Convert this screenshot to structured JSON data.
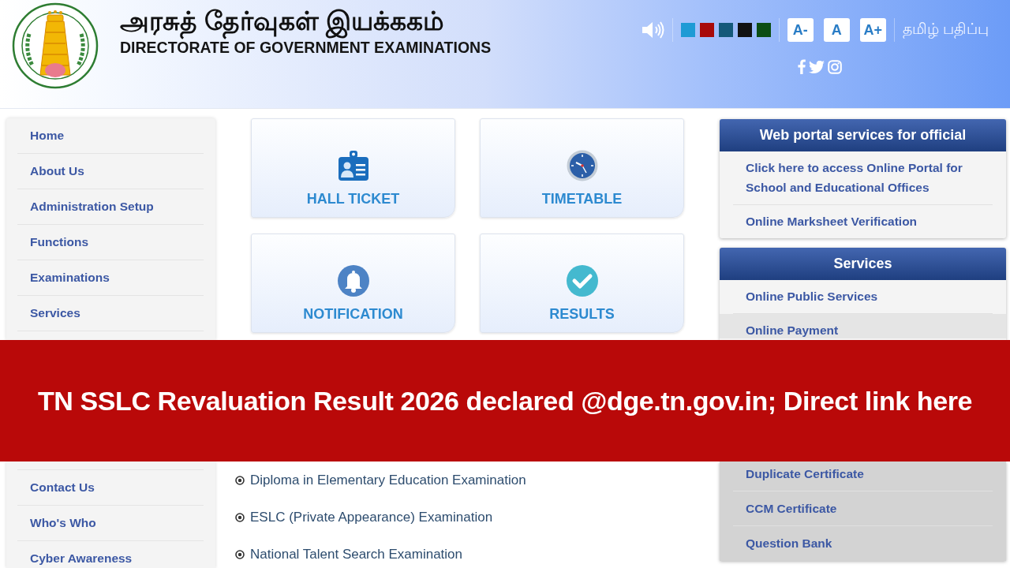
{
  "header": {
    "title_tamil": "அரசுத் தேர்வுகள் இயக்ககம்",
    "title_english": "DIRECTORATE OF GOVERNMENT EXAMINATIONS",
    "theme_swatches": [
      {
        "color": "#1e9bd5"
      },
      {
        "color": "#a80a0a"
      },
      {
        "color": "#14597a"
      },
      {
        "color": "#121212"
      },
      {
        "color": "#0c4e14"
      }
    ],
    "font_size_buttons": [
      "A-",
      "A",
      "A+"
    ],
    "language_link": "தமிழ் பதிப்பு"
  },
  "above_banner": {
    "sidebar_items": [
      "Home",
      "About Us",
      "Administration Setup",
      "Functions",
      "Examinations",
      "Services"
    ],
    "tiles": [
      {
        "kind": "hall_ticket",
        "label": "HALL TICKET"
      },
      {
        "kind": "timetable",
        "label": "TIMETABLE"
      },
      {
        "kind": "notification",
        "label": "NOTIFICATION"
      },
      {
        "kind": "results",
        "label": "RESULTS"
      }
    ],
    "side_panels": [
      {
        "title": "Web portal services for official",
        "links": [
          {
            "text": "Click here to access Online Portal for School and Educational Offices",
            "highlighted": false
          },
          {
            "text": "Online Marksheet Verification",
            "highlighted": false
          }
        ]
      },
      {
        "title": "Services",
        "links": [
          {
            "text": "Online Public Services",
            "highlighted": false
          },
          {
            "text": "Online Payment",
            "highlighted": true
          }
        ]
      }
    ]
  },
  "banner": {
    "headline": "TN SSLC Revaluation Result 2026 declared @dge.tn.gov.in; Direct link here"
  },
  "below_banner": {
    "sidebar_items": [
      "Contact Us",
      "Who's Who",
      "Cyber Awareness"
    ],
    "exam_links": [
      "Diploma in Elementary Education Examination",
      "ESLC (Private Appearance) Examination",
      "National Talent Search Examination"
    ],
    "side_panel_links": [
      "Duplicate Certificate",
      "CCM Certificate",
      "Question Bank"
    ]
  }
}
